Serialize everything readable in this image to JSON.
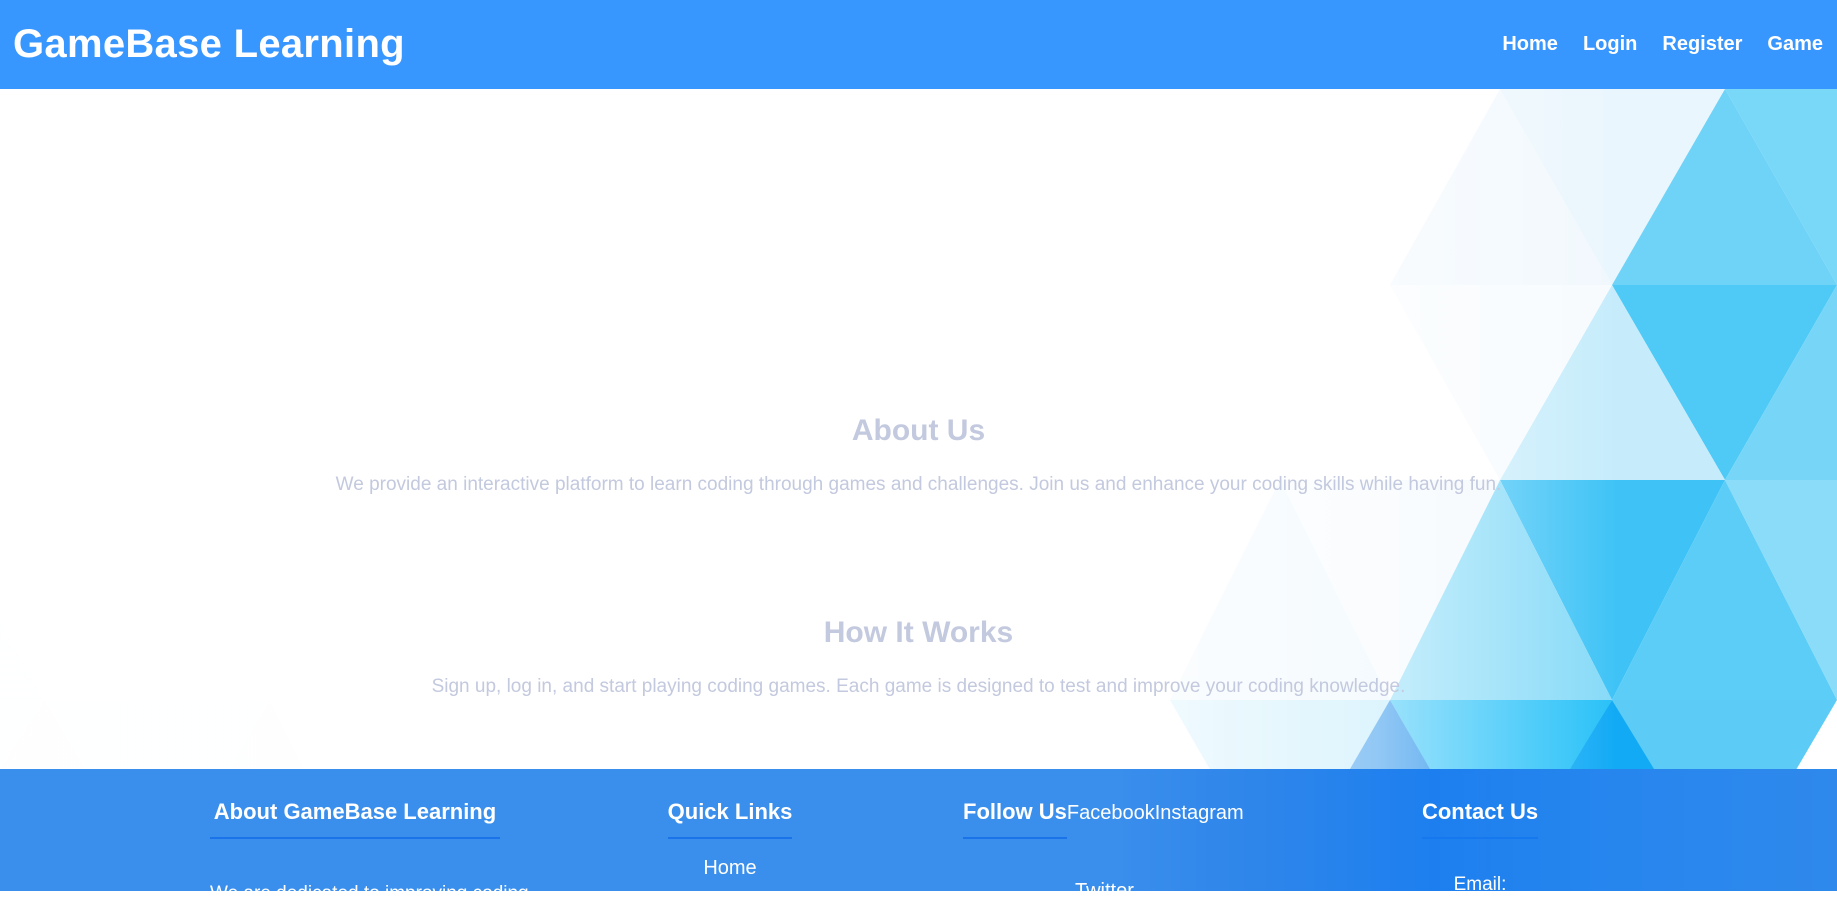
{
  "header": {
    "brand": "GameBase Learning",
    "nav": [
      "Home",
      "Login",
      "Register",
      "Game"
    ]
  },
  "about": {
    "title": "About Us",
    "text": "We provide an interactive platform to learn coding through games and challenges. Join us and enhance your coding skills while having fun."
  },
  "how": {
    "title": "How It Works",
    "text": "Sign up, log in, and start playing coding games. Each game is designed to test and improve your coding knowledge."
  },
  "footer": {
    "about": {
      "title": "About GameBase Learning",
      "text": "We are dedicated to improving coding"
    },
    "quick": {
      "title": "Quick Links",
      "links": [
        "Home"
      ]
    },
    "follow": {
      "title": "Follow Us",
      "links": [
        "Facebook",
        "Instagram",
        "Twitter"
      ]
    },
    "contact": {
      "title": "Contact Us",
      "text": "Email:"
    }
  },
  "colors": {
    "header": "#3896ff",
    "footer": "#3a8fed",
    "muted_text": "#c3c9de",
    "accent_underline": "#1a73e8"
  }
}
